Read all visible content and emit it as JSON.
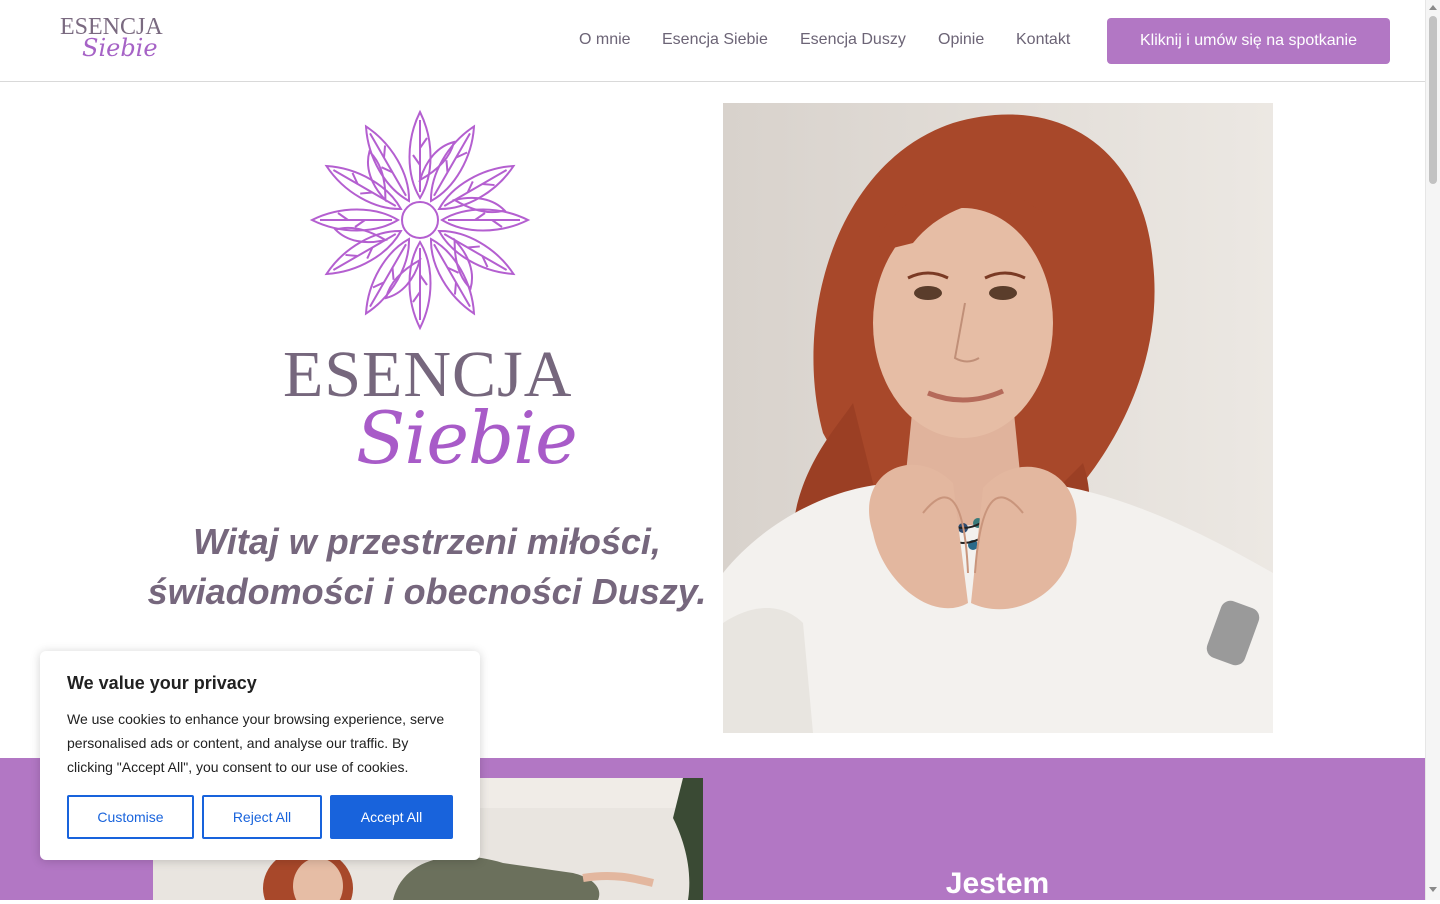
{
  "header": {
    "logo": {
      "line1": "ESENCJA",
      "line2": "Siebie"
    },
    "nav": [
      {
        "label": "O mnie"
      },
      {
        "label": "Esencja Siebie"
      },
      {
        "label": "Esencja Duszy"
      },
      {
        "label": "Opinie"
      },
      {
        "label": "Kontakt"
      }
    ],
    "cta_label": "Kliknij i umów się na spotkanie"
  },
  "hero": {
    "logo": {
      "line1": "ESENCJA",
      "line2": "Siebie"
    },
    "tagline_line1": "Witaj w przestrzeni miłości,",
    "tagline_line2": "świadomości i obecności Duszy.",
    "photo_icon": "portrait-photo"
  },
  "section2": {
    "heading": "Jestem",
    "photo_icon": "reclining-portrait-photo"
  },
  "cookie": {
    "title": "We value your privacy",
    "text": "We use cookies to enhance your browsing experience, serve personalised ads or content, and analyse our traffic. By clicking \"Accept All\", you consent to our use of cookies.",
    "customise": "Customise",
    "reject": "Reject All",
    "accept": "Accept All"
  },
  "colors": {
    "brand_purple": "#b277c4",
    "logo_grey": "#76677d",
    "cookie_blue": "#1863dc"
  }
}
